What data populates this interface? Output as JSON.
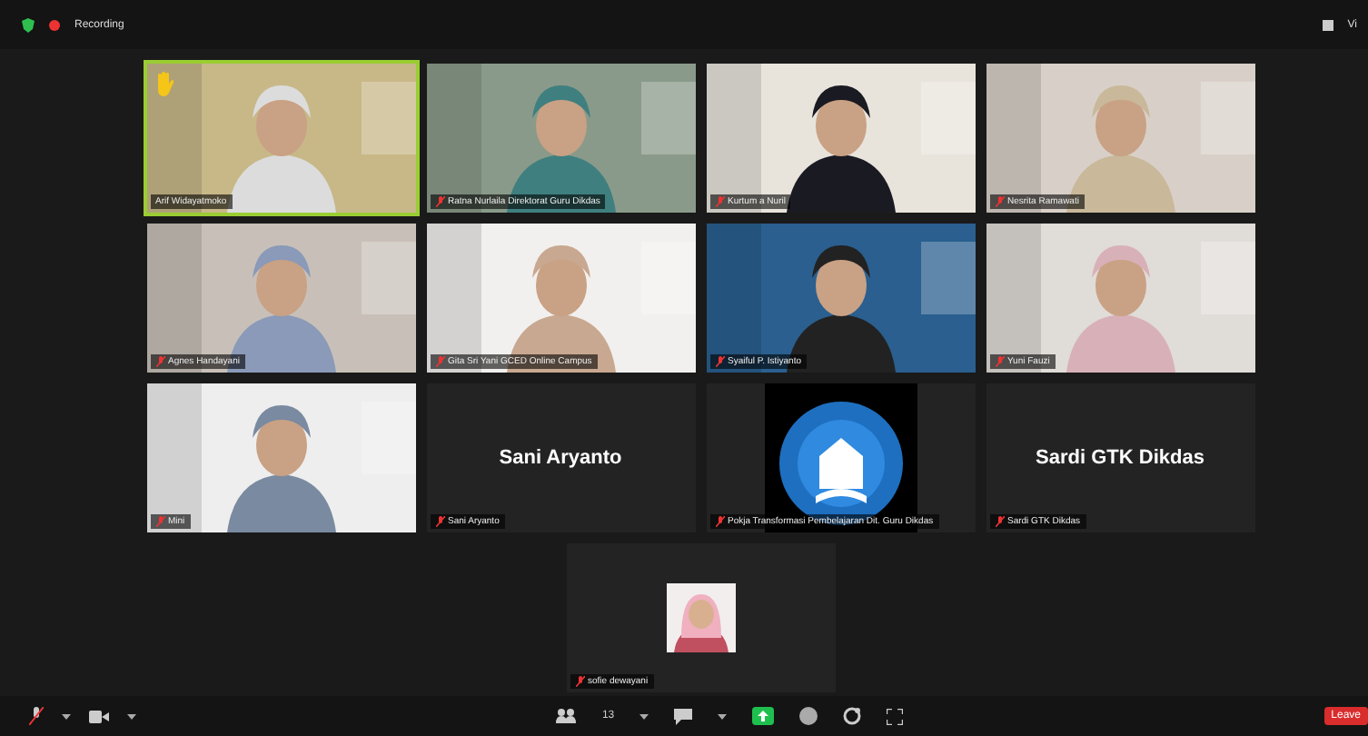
{
  "top_bar": {
    "recording_label": "Recording",
    "view_label": "Vi"
  },
  "tiles": [
    {
      "kind": "video",
      "name": "Arif Widayatmoko",
      "muted": false,
      "active_speaker": true,
      "hand_raised": true
    },
    {
      "kind": "video",
      "name": "Ratna Nurlaila Direktorat Guru Dikdas",
      "muted": true,
      "active_speaker": false,
      "hand_raised": false
    },
    {
      "kind": "video",
      "name": "Kurtum a Nuril",
      "muted": true,
      "active_speaker": false,
      "hand_raised": false
    },
    {
      "kind": "video",
      "name": "Nesrita Ramawati",
      "muted": true,
      "active_speaker": false,
      "hand_raised": false
    },
    {
      "kind": "video",
      "name": "Agnes Handayani",
      "muted": true,
      "active_speaker": false,
      "hand_raised": false
    },
    {
      "kind": "video",
      "name": "Gita Sri Yani GCED Online Campus",
      "muted": true,
      "active_speaker": false,
      "hand_raised": false
    },
    {
      "kind": "video",
      "name": "Syaiful P. Istiyanto",
      "muted": true,
      "active_speaker": false,
      "hand_raised": false
    },
    {
      "kind": "video",
      "name": "Yuni Fauzi",
      "muted": true,
      "active_speaker": false,
      "hand_raised": false
    },
    {
      "kind": "video",
      "name": "Mini",
      "muted": true,
      "active_speaker": false,
      "hand_raised": false
    },
    {
      "kind": "name",
      "name": "Sani Aryanto",
      "display": "Sani Aryanto",
      "muted": true,
      "active_speaker": false,
      "hand_raised": false
    },
    {
      "kind": "logo",
      "name": "Pokja Transformasi Pembelajaran Dit. Guru Dikdas",
      "muted": true,
      "active_speaker": false,
      "hand_raised": false
    },
    {
      "kind": "name",
      "name": "Sardi GTK Dikdas",
      "display": "Sardi GTK Dikdas",
      "muted": true,
      "active_speaker": false,
      "hand_raised": false
    },
    {
      "kind": "avatar",
      "name": "sofie dewayani",
      "muted": true,
      "active_speaker": false,
      "hand_raised": false
    }
  ],
  "toolbar": {
    "participants_count": "13",
    "leave_label": "Leave"
  }
}
